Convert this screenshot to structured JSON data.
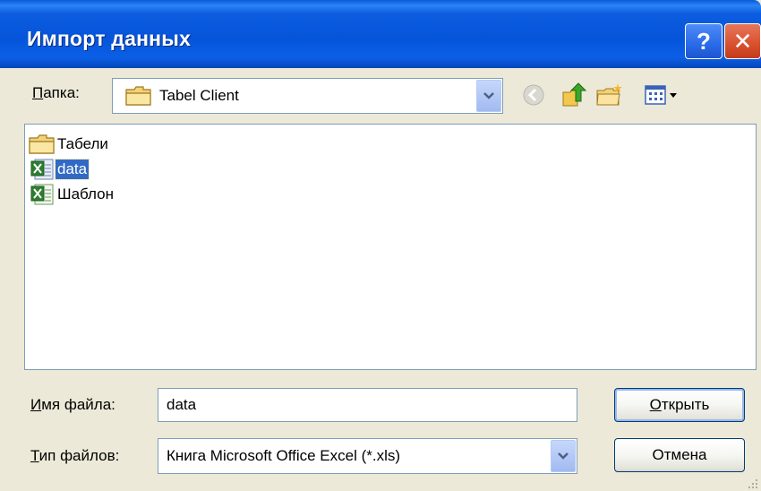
{
  "window": {
    "title": "Импорт данных",
    "help_label": "?",
    "close_label": "✕"
  },
  "folder": {
    "label_underlined": "П",
    "label_rest": "апка:",
    "value": "Tabel Client"
  },
  "files": [
    {
      "name": "Табели",
      "icon": "folder-icon",
      "selected": false
    },
    {
      "name": "data",
      "icon": "excel-file-icon",
      "selected": true
    },
    {
      "name": "Шаблон",
      "icon": "excel-file-icon",
      "selected": false
    }
  ],
  "filename": {
    "label_underlined": "И",
    "label_rest": "мя файла:",
    "value": "data"
  },
  "filetype": {
    "label_underlined": "Т",
    "label_rest": "ип файлов:",
    "value": "Книга Microsoft Office Excel (*.xls)"
  },
  "buttons": {
    "open_underlined": "О",
    "open_rest": "ткрыть",
    "cancel": "Отмена"
  },
  "colors": {
    "titlebar": "#0554DA",
    "selection": "#316AC5",
    "dialog_bg": "#ECE9D8"
  }
}
